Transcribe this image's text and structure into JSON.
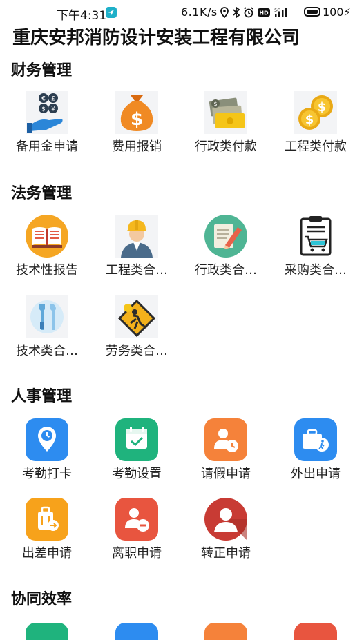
{
  "status": {
    "time": "下午4:31",
    "speed": "6.1K/s",
    "battery": "100"
  },
  "header": {
    "title": "重庆安邦消防设计安装工程有限公司"
  },
  "sections": {
    "finance": {
      "title": "财务管理",
      "items": [
        "备用金申请",
        "费用报销",
        "行政类付款",
        "工程类付款"
      ]
    },
    "legal": {
      "title": "法务管理",
      "items": [
        "技术性报告",
        "工程类合…",
        "行政类合…",
        "采购类合…",
        "技术类合…",
        "劳务类合…"
      ]
    },
    "hr": {
      "title": "人事管理",
      "items": [
        "考勤打卡",
        "考勤设置",
        "请假申请",
        "外出申请",
        "出差申请",
        "离职申请",
        "转正申请"
      ]
    },
    "collab": {
      "title": "协同效率"
    }
  },
  "icons": {
    "petty_cash": "coins-hand-icon",
    "expense": "money-bag-icon",
    "admin_payment": "cash-bills-icon",
    "project_payment": "gold-coins-icon",
    "tech_report": "open-book-icon",
    "project_contract": "engineer-icon",
    "admin_contract": "notepad-pencil-icon",
    "purchase_contract": "shopping-cart-clipboard-icon",
    "tech_contract": "tools-icon",
    "labor_contract": "construction-sign-icon",
    "attendance_clock": "location-clock-icon",
    "attendance_settings": "calendar-check-icon",
    "leave_request": "person-clock-icon",
    "outing_request": "briefcase-walk-icon",
    "business_trip": "luggage-icon",
    "resignation": "person-minus-icon",
    "regularization": "person-badge-icon"
  },
  "colors": {
    "blue": "#2d8cf0",
    "green": "#1fb37d",
    "orange": "#f5823a",
    "amber": "#f7a21b",
    "red": "#e8553f",
    "dark_red": "#c83b34"
  }
}
